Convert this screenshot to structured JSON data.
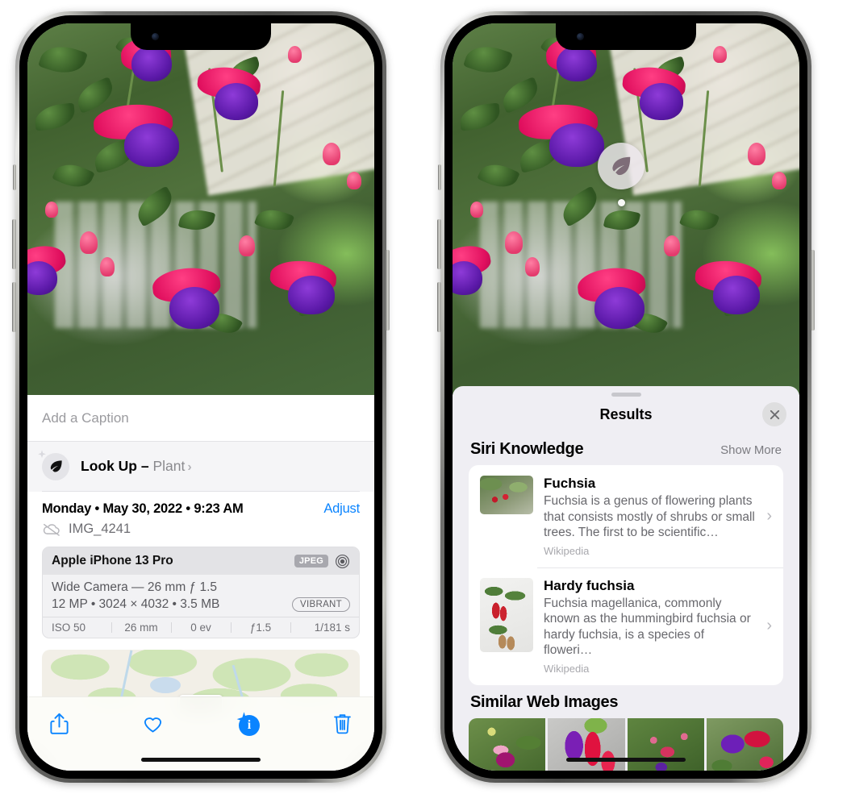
{
  "left_phone": {
    "photo": {
      "alt": "fuchsia-flowers-photo"
    },
    "caption_placeholder": "Add a Caption",
    "lookup": {
      "icon": "leaf-icon",
      "sparkle_icon": "sparkle-icon",
      "label": "Look Up – ",
      "subject": "Plant",
      "chevron": "›"
    },
    "metadata": {
      "datetime": "Monday • May 30, 2022 • 9:23 AM",
      "adjust_label": "Adjust",
      "cloud_icon": "cloud-slash-icon",
      "filename": "IMG_4241"
    },
    "exif": {
      "device": "Apple iPhone 13 Pro",
      "format_badge": "JPEG",
      "lens_icon": "lens-icon",
      "lens_line": "Wide Camera — 26 mm ƒ 1.5",
      "specs_line": "12 MP • 3024 × 4032 • 3.5 MB",
      "style_badge": "VIBRANT",
      "settings": [
        "ISO 50",
        "26 mm",
        "0 ev",
        "ƒ1.5",
        "1/181 s"
      ]
    },
    "map": {
      "name": "photo-location-map"
    },
    "toolbar": [
      {
        "name": "share-button",
        "icon": "share-icon"
      },
      {
        "name": "favorite-button",
        "icon": "heart-icon"
      },
      {
        "name": "info-button",
        "icon": "info-sparkle-icon",
        "glyph": "i"
      },
      {
        "name": "delete-button",
        "icon": "trash-icon"
      }
    ]
  },
  "right_phone": {
    "photo": {
      "alt": "fuchsia-flowers-photo"
    },
    "badge": {
      "icon": "leaf-icon"
    },
    "sheet": {
      "title": "Results",
      "close_icon": "close-icon",
      "siri_knowledge": {
        "heading": "Siri Knowledge",
        "action": "Show More",
        "items": [
          {
            "title": "Fuchsia",
            "description": "Fuchsia is a genus of flowering plants that consists mostly of shrubs or small trees. The first to be scientific…",
            "source": "Wikipedia",
            "chevron": "›"
          },
          {
            "title": "Hardy fuchsia",
            "description": "Fuchsia magellanica, commonly known as the hummingbird fuchsia or hardy fuchsia, is a species of floweri…",
            "source": "Wikipedia",
            "chevron": "›"
          }
        ]
      },
      "similar_web_images": {
        "heading": "Similar Web Images",
        "thumbs": [
          {
            "name": "similar-image-1"
          },
          {
            "name": "similar-image-2"
          },
          {
            "name": "similar-image-3"
          },
          {
            "name": "similar-image-4"
          }
        ]
      }
    }
  },
  "colors": {
    "accent_blue": "#0a84ff",
    "sheet_bg": "#efeef3",
    "card_bg": "#ffffff",
    "secondary_text": "#68686d"
  }
}
